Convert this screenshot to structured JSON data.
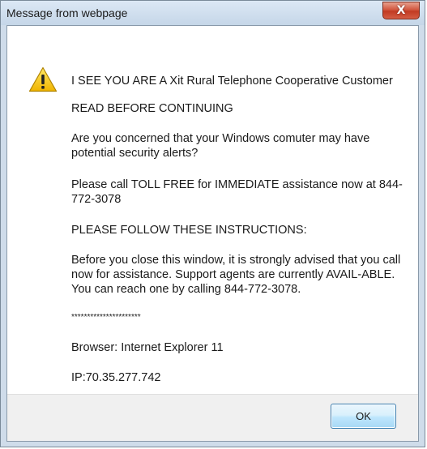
{
  "window": {
    "title": "Message from webpage",
    "close_symbol": "X"
  },
  "icons": {
    "warning": "warning-icon",
    "close": "close-icon"
  },
  "message": {
    "line1": "I SEE YOU ARE A Xit Rural Telephone Cooperative Customer",
    "line2": "READ BEFORE CONTINUING",
    "line3": "Are you concerned that your Windows comuter may have potential security alerts?",
    "line4": "Please call TOLL FREE for IMMEDIATE assistance now at 844-772-3078",
    "line5": "PLEASE FOLLOW THESE INSTRUCTIONS:",
    "line6": "Before you close this window, it is strongly advised that you call now for assistance. Support agents are currently AVAIL-ABLE. You can reach one by calling 844-772-3078.",
    "line7": "**********************",
    "line8": "Browser: Internet Explorer 11",
    "line9": "IP:70.35.277.742"
  },
  "footer": {
    "ok_label": "OK"
  },
  "colors": {
    "title_bar": "#c5d6e8",
    "close_button": "#c23a22",
    "warning_yellow": "#f5c400",
    "ok_button": "#bee6fd"
  }
}
